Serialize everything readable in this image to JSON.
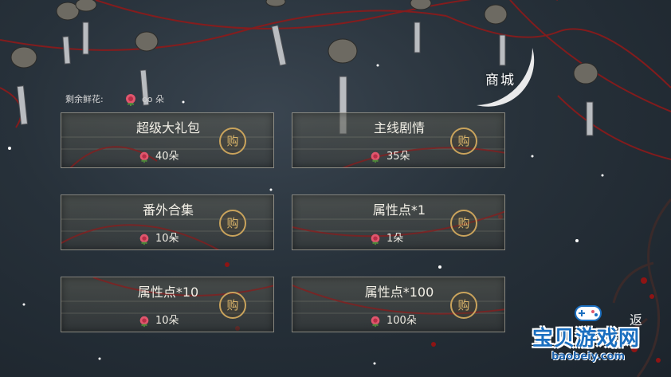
{
  "header": {
    "flowers_label": "剩余鲜花:",
    "flowers_count": "oo 朵",
    "shop_title": "商城"
  },
  "items": [
    {
      "name": "超级大礼包",
      "price": "40朵",
      "buy_label": "购"
    },
    {
      "name": "主线剧情",
      "price": "35朵",
      "buy_label": "购"
    },
    {
      "name": "番外合集",
      "price": "10朵",
      "buy_label": "购"
    },
    {
      "name": "属性点*1",
      "price": "1朵",
      "buy_label": "购"
    },
    {
      "name": "属性点*10",
      "price": "10朵",
      "buy_label": "购"
    },
    {
      "name": "属性点*100",
      "price": "100朵",
      "buy_label": "购"
    }
  ],
  "back_label": "返",
  "watermark": {
    "main": "宝贝游戏网",
    "url": "baobeiy.com"
  },
  "icons": {
    "currency": "rose-flower-icon",
    "buy": "buy-seal-icon"
  },
  "colors": {
    "accent_gold": "#c9a35c",
    "thread_red": "#9b1c1c",
    "watermark_blue": "#1b6fc0"
  }
}
